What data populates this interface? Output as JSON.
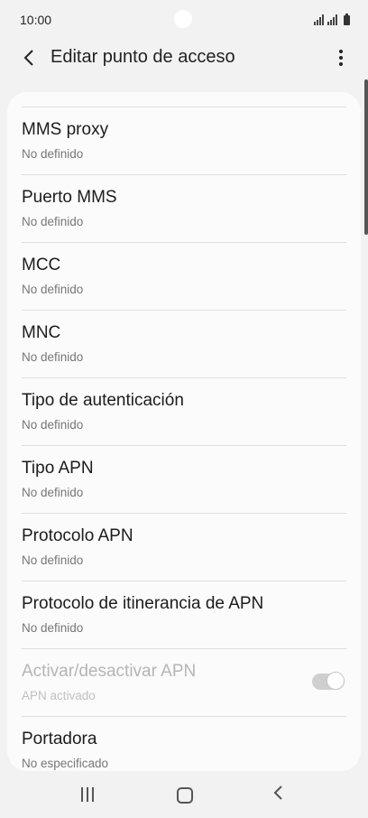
{
  "status_bar": {
    "time": "10:00"
  },
  "app_bar": {
    "title": "Editar punto de acceso"
  },
  "settings": {
    "items": [
      {
        "label": "MMS proxy",
        "value": "No definido"
      },
      {
        "label": "Puerto MMS",
        "value": "No definido"
      },
      {
        "label": "MCC",
        "value": "No definido"
      },
      {
        "label": "MNC",
        "value": "No definido"
      },
      {
        "label": "Tipo de autenticación",
        "value": "No definido"
      },
      {
        "label": "Tipo APN",
        "value": "No definido"
      },
      {
        "label": "Protocolo APN",
        "value": "No definido"
      },
      {
        "label": "Protocolo de itinerancia de APN",
        "value": "No definido"
      },
      {
        "label": "Activar/desactivar APN",
        "value": "APN activado",
        "toggle": "on",
        "disabled": true
      },
      {
        "label": "Portadora",
        "value": "No especificado"
      }
    ]
  },
  "icons": {
    "back": "chevron-left-icon",
    "menu": "more-vertical-icon",
    "nav_recents": "recents-icon",
    "nav_home": "home-icon",
    "nav_back": "back-icon"
  }
}
